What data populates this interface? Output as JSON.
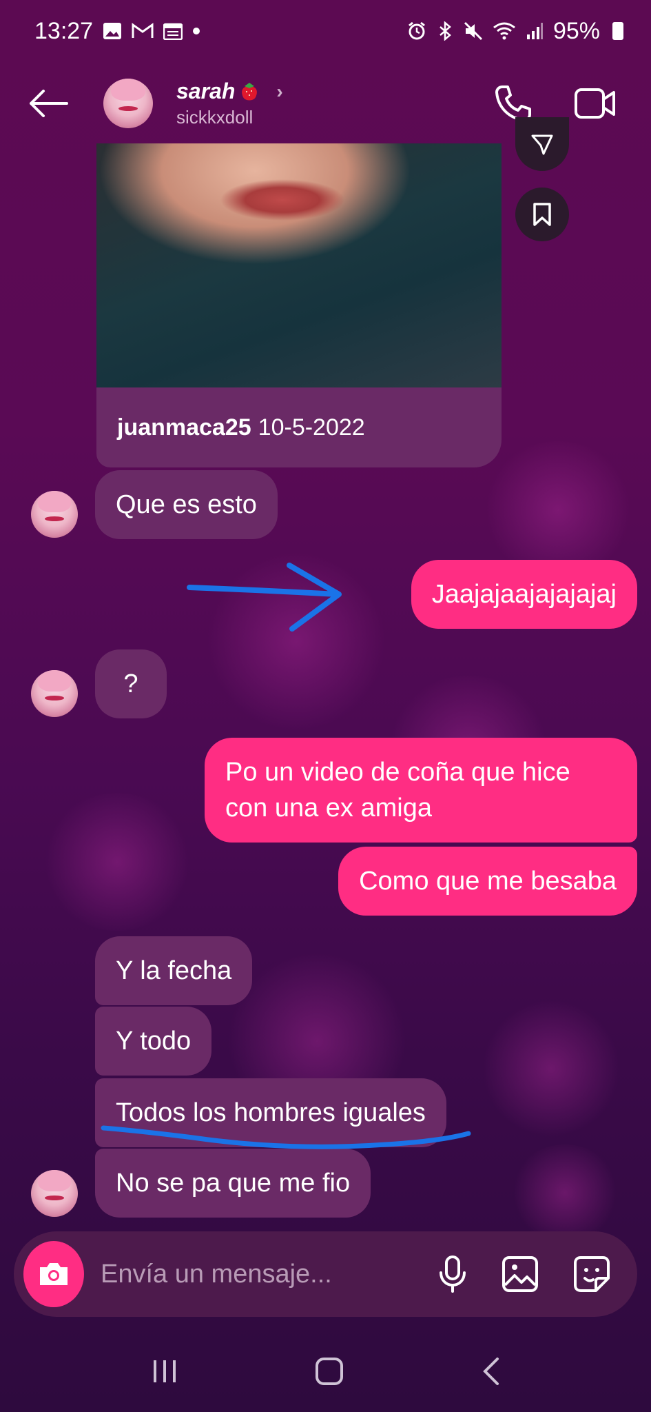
{
  "status_bar": {
    "time": "13:27",
    "battery": "95%",
    "left_icons": [
      "image-icon",
      "gmail-icon",
      "calendar-icon",
      "dot-icon"
    ],
    "right_icons": [
      "alarm-icon",
      "bluetooth-icon",
      "mute-icon",
      "wifi-icon",
      "signal-icon",
      "battery-icon"
    ]
  },
  "header": {
    "name": "sarah",
    "username": "sickkxdoll",
    "name_emoji": "strawberry-icon"
  },
  "shared_post": {
    "author": "juanmaca25",
    "date": "10-5-2022"
  },
  "messages": [
    {
      "side": "in",
      "text": "Que es esto"
    },
    {
      "side": "out",
      "text": "Jaajajaajajajajaj"
    },
    {
      "side": "in",
      "text": "?"
    },
    {
      "side": "out",
      "text": "Po un video de coña que hice con una ex amiga"
    },
    {
      "side": "out",
      "text": "Como que me besaba"
    },
    {
      "side": "in",
      "text": "Y la fecha"
    },
    {
      "side": "in",
      "text": "Y todo"
    },
    {
      "side": "in",
      "text": "Todos los hombres iguales"
    },
    {
      "side": "in",
      "text": "No se pa que me fio"
    }
  ],
  "composer": {
    "placeholder": "Envía un mensaje..."
  },
  "colors": {
    "outgoing_bubble": "#ff2d83",
    "incoming_bubble": "#6a2a66",
    "annotation_blue": "#1a73e8"
  }
}
